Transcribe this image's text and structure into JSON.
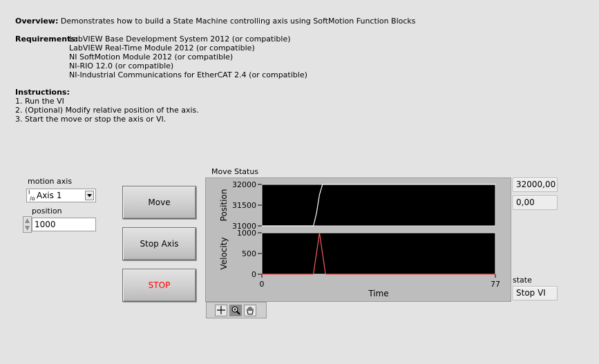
{
  "overview": {
    "label": "Overview:",
    "text": "Demonstrates how to build a State Machine controlling axis using SoftMotion Function Blocks"
  },
  "requirements": {
    "label": "Requirements:",
    "items": [
      "LabVIEW Base Development System 2012 (or compatible)",
      "LabVIEW Real-Time Module 2012 (or compatible)",
      "NI SoftMotion Module 2012 (or compatible)",
      "NI-RIO 12.0 (or compatible)",
      "NI-Industrial Communications for EtherCAT 2.4 (or compatible)"
    ]
  },
  "instructions": {
    "label": "Instructions:",
    "steps": [
      "1. Run the VI",
      "2. (Optional) Modify relative position of the axis.",
      "3. Start the move or stop the axis or VI."
    ]
  },
  "motion_axis": {
    "label": "motion axis",
    "value": "Axis 1",
    "io_glyph": "I/O"
  },
  "position": {
    "label": "position",
    "value": "1000"
  },
  "buttons": {
    "move": "Move",
    "stop_axis": "Stop Axis",
    "stop": "STOP",
    "stop_color": "#ff0000"
  },
  "move_status": {
    "label": "Move Status",
    "position_readout": "32000,00",
    "velocity_readout": "0,00"
  },
  "state": {
    "label": "state",
    "value": "Stop VI"
  },
  "chart_data": [
    {
      "type": "line",
      "ylabel": "Position",
      "ylim": [
        31000,
        32000
      ],
      "yticks": [
        "32000",
        "31500",
        "31000"
      ],
      "ytick_values": [
        32000,
        31500,
        31000
      ],
      "xlim": [
        0,
        77
      ],
      "series": [
        {
          "color": "#ffffff",
          "x": [
            0,
            17,
            18,
            19,
            20,
            77
          ],
          "y": [
            31000,
            31000,
            31300,
            31750,
            32000,
            32000
          ]
        }
      ]
    },
    {
      "type": "line",
      "ylabel": "Velocity",
      "xlabel": "Time",
      "ylim": [
        0,
        1000
      ],
      "yticks": [
        "1000",
        "500",
        "0"
      ],
      "ytick_values": [
        1000,
        500,
        0
      ],
      "xlim": [
        0,
        77
      ],
      "xticks": [
        "0",
        "77"
      ],
      "xtick_values": [
        0,
        77
      ],
      "series": [
        {
          "color": "#ff5a5a",
          "x": [
            0,
            17,
            19,
            21,
            77
          ],
          "y": [
            0,
            0,
            1000,
            0,
            0
          ]
        }
      ]
    }
  ],
  "palette": {
    "cursor_icon": "crosshair-icon",
    "zoom_icon": "zoom-icon",
    "pan_icon": "hand-pan-icon"
  },
  "colors": {
    "panel_bg": "#e3e3e3",
    "plot_bg": "#000000",
    "plot_frame": "#bdbdbd"
  }
}
